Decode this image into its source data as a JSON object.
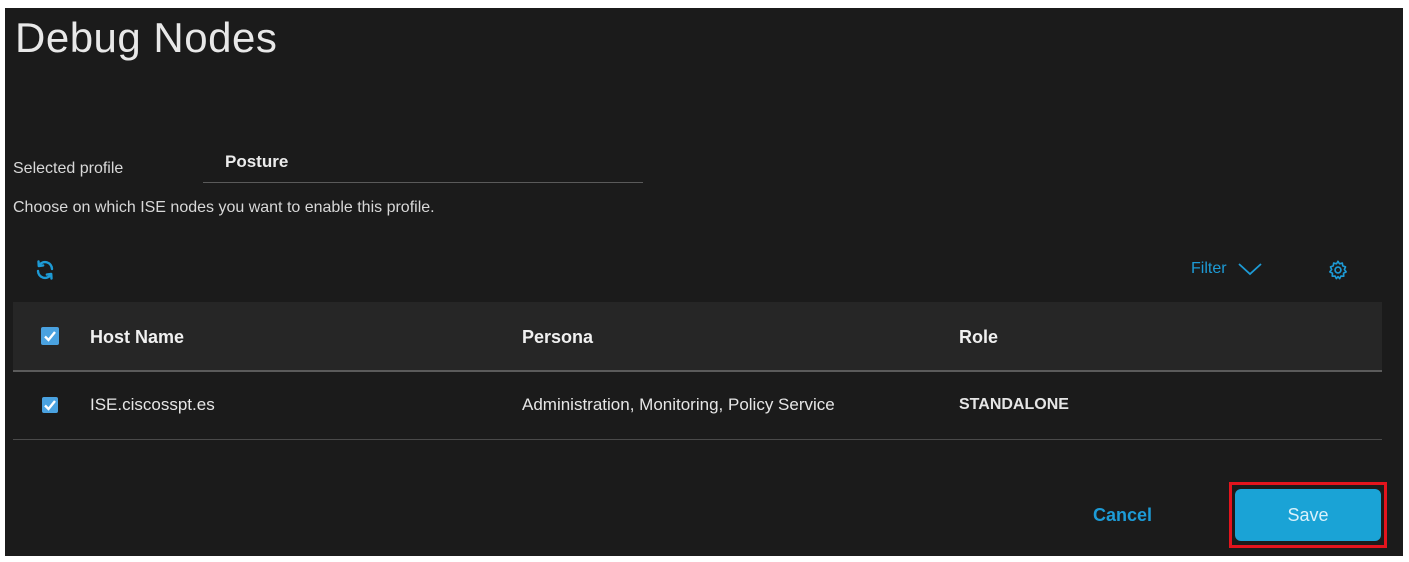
{
  "page": {
    "title": "Debug Nodes"
  },
  "profile": {
    "label": "Selected profile",
    "value": "Posture"
  },
  "instruction": "Choose on which ISE nodes you want to enable this profile.",
  "toolbar": {
    "refresh_icon": "refresh-icon",
    "filter_label": "Filter",
    "filter_icon": "chevron-down-icon",
    "settings_icon": "gear-icon"
  },
  "table": {
    "select_all_checked": true,
    "headers": {
      "host_name": "Host Name",
      "persona": "Persona",
      "role": "Role"
    },
    "rows": [
      {
        "checked": true,
        "host_name": "ISE.ciscosspt.es",
        "persona": "Administration, Monitoring, Policy Service",
        "role": "STANDALONE"
      }
    ]
  },
  "actions": {
    "cancel_label": "Cancel",
    "save_label": "Save"
  },
  "colors": {
    "accent": "#1d9bd6",
    "checkbox": "#4aa2e0",
    "highlight": "#e3141d",
    "background": "#1b1b1b"
  }
}
